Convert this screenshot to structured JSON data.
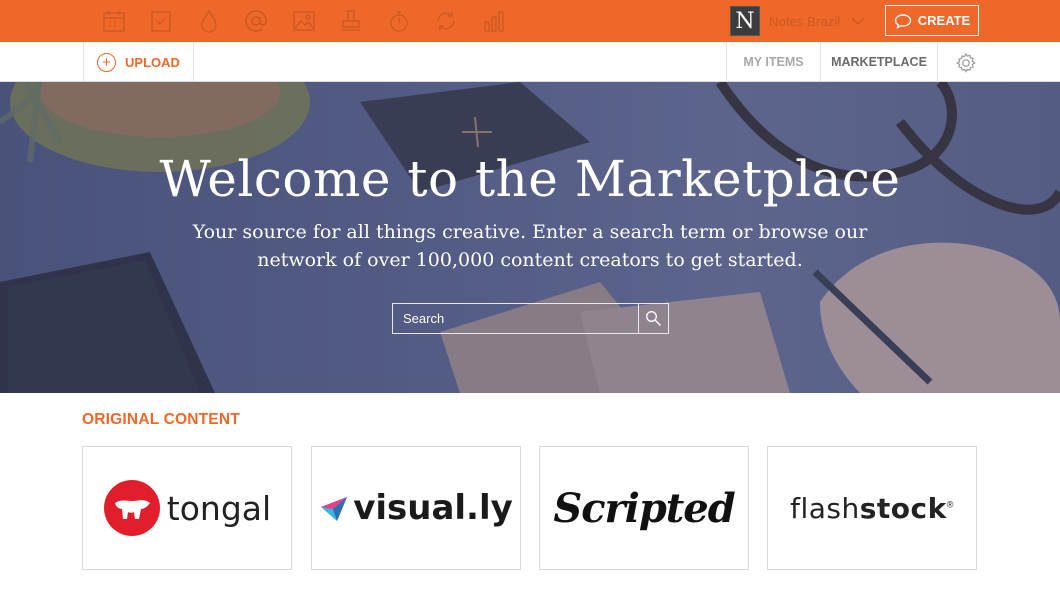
{
  "topbar": {
    "tools": [
      {
        "icon": "calendar-icon"
      },
      {
        "icon": "task-icon"
      },
      {
        "icon": "drop-icon"
      },
      {
        "icon": "at-icon"
      },
      {
        "icon": "image-icon"
      },
      {
        "icon": "stamp-icon"
      },
      {
        "icon": "stopwatch-icon"
      },
      {
        "icon": "cycle-icon"
      },
      {
        "icon": "bar-chart-icon"
      }
    ],
    "account": {
      "logo_letter": "N",
      "name": "Notes Brazil"
    },
    "create_label": "CREATE"
  },
  "subnav": {
    "upload_label": "UPLOAD",
    "tabs": [
      {
        "label": "MY ITEMS"
      },
      {
        "label": "MARKETPLACE"
      }
    ]
  },
  "hero": {
    "title": "Welcome to the Marketplace",
    "subtitle_line1": "Your source for all things creative. Enter a search term or browse our",
    "subtitle_line2": "network of over 100,000 content creators to get started.",
    "search_placeholder": "Search"
  },
  "section": {
    "title": "ORIGINAL CONTENT",
    "partners": [
      {
        "name": "tongal"
      },
      {
        "name": "visual.ly"
      },
      {
        "name": "Scripted"
      },
      {
        "name_part1": "flash",
        "name_part2": "stock"
      }
    ]
  },
  "colors": {
    "brand": "#f0672a",
    "hero_tint": "#4a5276"
  }
}
